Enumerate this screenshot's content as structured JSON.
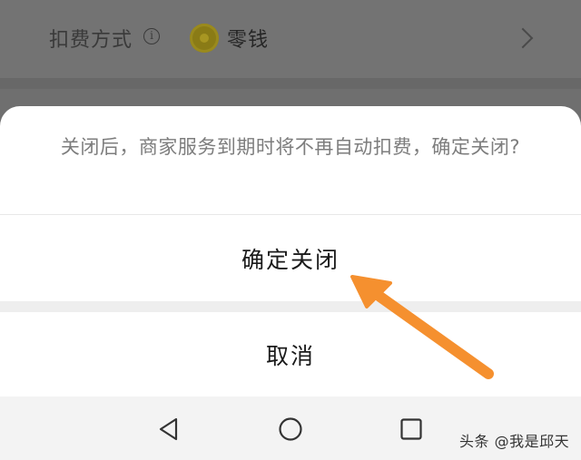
{
  "background": {
    "row_label": "扣费方式",
    "info_icon": "info-icon",
    "coin_icon": "coin-icon",
    "row_value": "零钱",
    "chevron_icon": "chevron-right-icon"
  },
  "sheet": {
    "message": "关闭后，商家服务到期时将不再自动扣费，确定关闭?",
    "confirm_label": "确定关闭",
    "cancel_label": "取消"
  },
  "nav": {
    "back_icon": "triangle-back-icon",
    "home_icon": "circle-home-icon",
    "recent_icon": "square-recent-icon"
  },
  "watermark": "头条 @我是邱天",
  "colors": {
    "overlay": "#6b6b6b",
    "sheet": "#ffffff",
    "arrow": "#f5902f",
    "nav_bar": "#f3f3f3"
  }
}
